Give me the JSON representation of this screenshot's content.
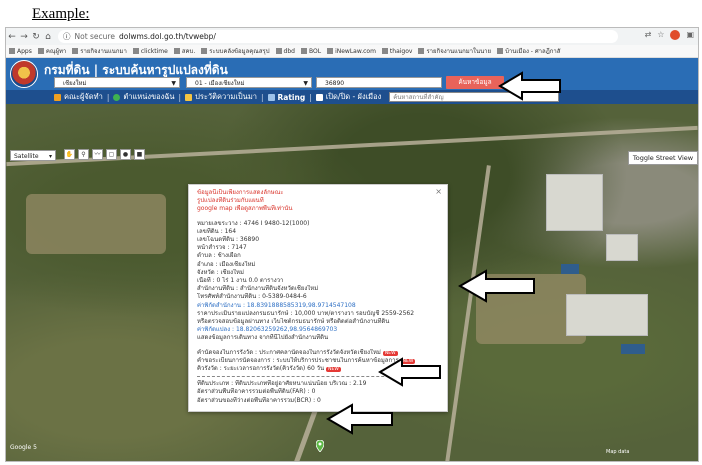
{
  "caption": "Example:",
  "browser": {
    "url_insecure": "Not secure",
    "url": "dolwms.dol.go.th/tvwebp/",
    "bookmarks": [
      "Apps",
      "คณุผู้ทา",
      "รายกิจงานแนกมา",
      "clicktime",
      "สคบ.",
      "ระบบคลังข้อมูลคุณสรุป",
      "dbd",
      "BOL",
      "iNewLaw.com",
      "thaigov",
      "รายกิจงานแนกมาในนาย",
      "บ้านเมือง - ศาลฎีกาสั"
    ]
  },
  "header": {
    "title": "กรมที่ดิน | ระบบค้นหารูปแปลงที่ดิน",
    "province": "เชียงใหม่",
    "district": "01 - เมืองเชียงใหม่",
    "parcel_no": "36890",
    "search_label": "ค้นหาข้อมูล"
  },
  "menu": {
    "item1": "คณะผู้จัดทำ",
    "item2": "ตำแหน่งของฉัน",
    "item3": "ประวัติความเป็นมา",
    "item4": "Rating",
    "item5": "เปิด/ปิด - ผังเมือง",
    "place_placeholder": "ค้นหาสถานที่สำคัญ"
  },
  "map": {
    "type": "Satellite",
    "street_view": "Toggle Street View"
  },
  "popup": {
    "disclaimer1": "ข้อมูลนี้เป็นเพียงการแสดงลักษณะ",
    "disclaimer2": "รูปแปลงที่ดินร่วมกับแผนที่",
    "disclaimer3": "google map เพื่อดูสภาพพื้นที่เท่านั้น",
    "lines": [
      "หมายเลขระวาง : 4746 I 9480-12(1000)",
      "เลขที่ดิน : 164",
      "เลขโฉนดที่ดิน : 36890",
      "หน้าสำรวจ : 7147",
      "ตำบล : ช้างเผือก",
      "อำเภอ : เมืองเชียงใหม่",
      "จังหวัด : เชียงใหม่",
      "เนื้อที่ : 0 ไร่ 1 งาน 0.0 ตารางวา",
      "สำนักงานที่ดิน : สำนักงานที่ดินจังหวัดเชียงใหม่",
      "โทรศัพท์สำนักงานที่ดิน : 0-5389-0484-6",
      "ค่าพิกัดสำนักงาน : 18.8391888585319,98.9714547108",
      "ราคาประเมินรายแปลงกรมธนารักษ์ : 10,000 บาท/ตารางวา รอบบัญชี 2559-2562",
      "หรือตรวจสอบข้อมูลผ่านทาง เว็บไซต์กรมธนารักษ์ หรือติดต่อสำนักงานที่ดิน",
      "ค่าพิกัดแปลง : 18.82063259262,98.9564869703",
      "แสดงข้อมูลการเดินทาง จากที่นี่ไปยังสำนักงานที่ดิน"
    ],
    "booking": "คำนัดจองในการรังวัด : ประกาศคลานัดจองในการรังวัดจังหวัดเชียงใหม่",
    "booking_status": "คำขอระเบียนการนัดจองการ : ระบบให้บริการประชาชนในการค้นหาข้อมูลการ",
    "survey_period": "คิวรังวัด : ระยะเวลารอการรังวัด(คิวรังวัด) 60 วัน",
    "new": "NEW",
    "zoning": "ที่ดินประเภท : ที่ดินประเภทที่อยู่อาศัยหนาแน่นน้อย บริเวณ : 2.19",
    "far": "อัตราส่วนพื้นที่อาคารรวมต่อพื้นที่ดิน(FAR) : 0",
    "bcr": "อัตราส่วนของที่ว่างต่อพื้นที่อาคารรวม(BCR) : 0"
  },
  "map_labels": [
    "Google 5",
    "Map data"
  ],
  "colors": {
    "header_blue": "#2a6db5",
    "menu_blue": "#1e4f8e",
    "search_red": "#e8635a",
    "link_blue": "#2d6fc4",
    "warn_red": "#d9342b"
  }
}
